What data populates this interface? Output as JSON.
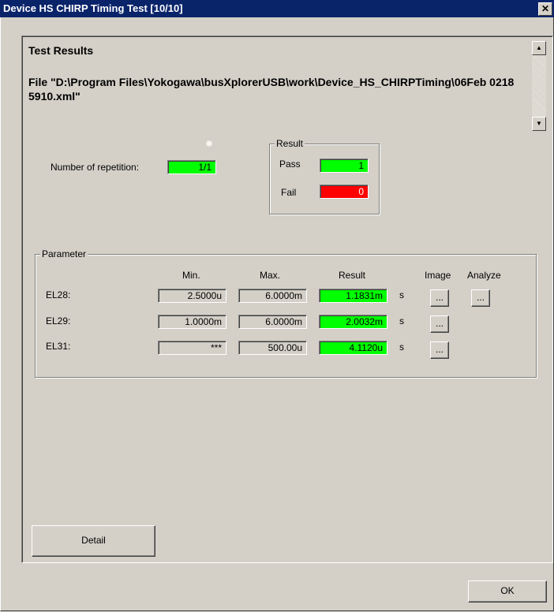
{
  "window": {
    "title": "Device HS CHIRP Timing Test [10/10]",
    "close_glyph": "✕"
  },
  "header": {
    "title": "Test Results",
    "file_text": "File \"D:\\Program Files\\Yokogawa\\busXplorerUSB\\work\\Device_HS_CHIRPTiming\\06Feb 02185910.xml\""
  },
  "scroll": {
    "up_glyph": "▲",
    "down_glyph": "▼"
  },
  "repetition": {
    "label": "Number of repetition:",
    "value": "1/1"
  },
  "result_group": {
    "title": "Result",
    "pass_label": "Pass",
    "pass_value": "1",
    "fail_label": "Fail",
    "fail_value": "0"
  },
  "parameter": {
    "title": "Parameter",
    "headers": {
      "min": "Min.",
      "max": "Max.",
      "result": "Result",
      "image": "Image",
      "analyze": "Analyze"
    },
    "rows": [
      {
        "name": "EL28:",
        "min": "2.5000u",
        "max": "6.0000m",
        "result": "1.1831m",
        "unit": "s",
        "image_btn": "...",
        "analyze_btn": "..."
      },
      {
        "name": "EL29:",
        "min": "1.0000m",
        "max": "6.0000m",
        "result": "2.0032m",
        "unit": "s",
        "image_btn": "..."
      },
      {
        "name": "EL31:",
        "min": "***",
        "max": "500.00u",
        "result": "4.1120u",
        "unit": "s",
        "image_btn": "..."
      }
    ]
  },
  "buttons": {
    "detail": "Detail",
    "ok": "OK"
  },
  "colors": {
    "pass": "#00ff00",
    "fail": "#ff0000",
    "titlebar": "#0a246a",
    "face": "#d4d0c8"
  }
}
